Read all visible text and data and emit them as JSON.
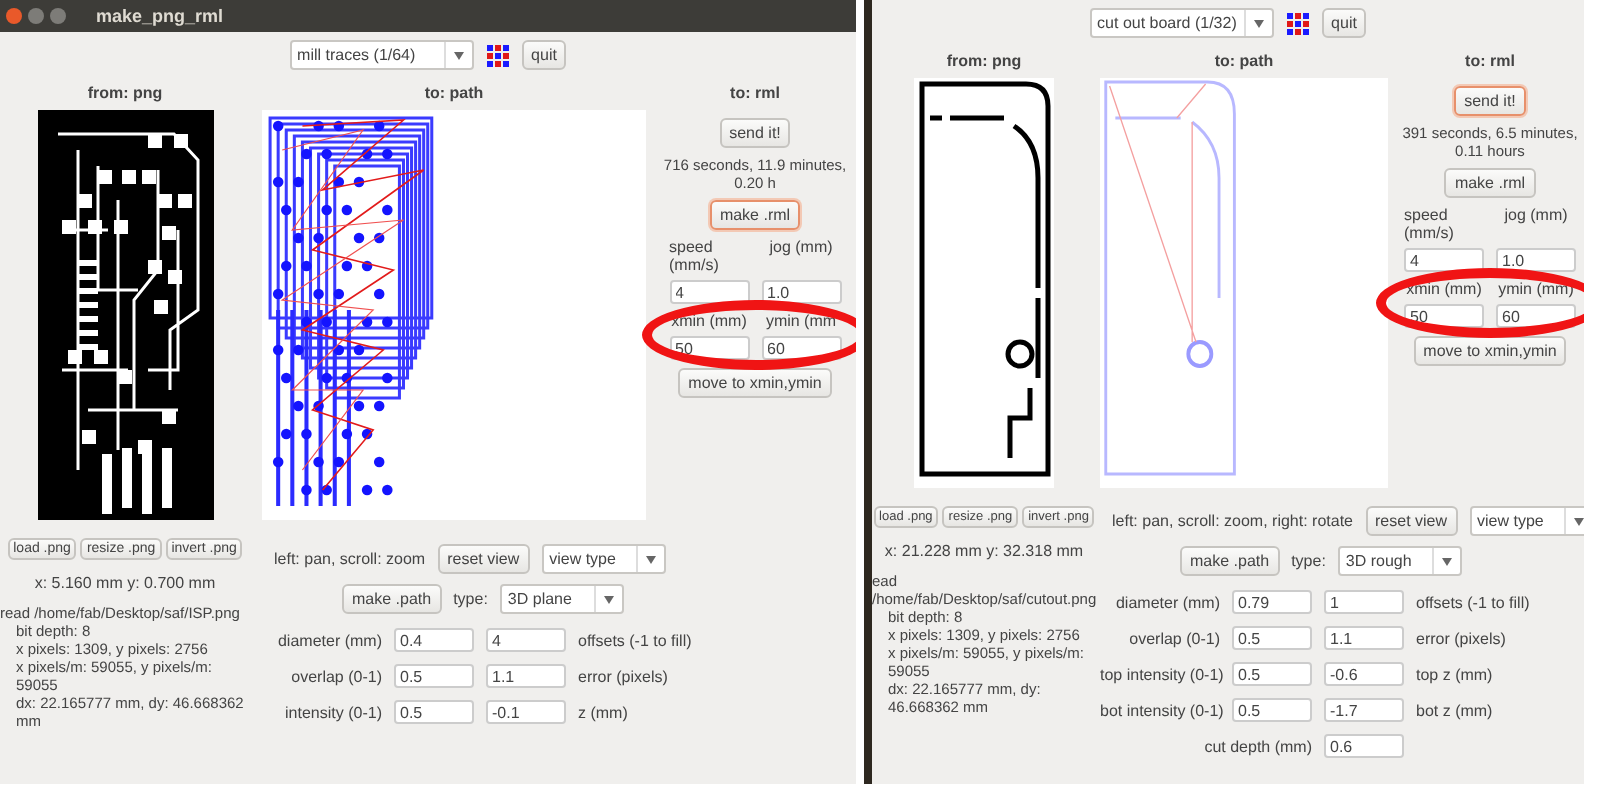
{
  "windows": [
    {
      "title": "make_png_rml",
      "toolbar": {
        "mode": "mill traces (1/64)",
        "quit": "quit"
      },
      "from_panel": {
        "heading": "from: png",
        "kind": "traces"
      },
      "path_panel": {
        "heading": "to: path",
        "kind": "traces"
      },
      "rml_panel": {
        "heading": "to: rml",
        "send": {
          "label": "send it!",
          "focused": false
        },
        "estimate": "716 seconds, 11.9 minutes, 0.20 h",
        "make": {
          "label": "make .rml",
          "focused": true
        },
        "speed_label": "speed (mm/s)",
        "jog_label": "jog (mm)",
        "speed": "4",
        "jog": "1.0",
        "xmin_label": "xmin (mm)",
        "ymin_label": "ymin (mm",
        "xmin": "50",
        "ymin": "60",
        "circled": true,
        "move": "move to xmin,ymin"
      },
      "png_buttons": [
        "load .png",
        "resize .png",
        "invert .png"
      ],
      "view_hint": "left: pan, scroll: zoom",
      "reset": "reset view",
      "view_type": "view type",
      "cursor": "x: 5.160 mm y: 0.700 mm",
      "info": [
        "read /home/fab/Desktop/saf/ISP.png",
        "bit depth: 8",
        "x pixels: 1309, y pixels: 2756",
        "x pixels/m: 59055, y pixels/m: 59055",
        "dx: 22.165777 mm, dy: 46.668362 mm"
      ],
      "make_path": "make .path",
      "type_label": "type:",
      "type": "3D plane",
      "params": [
        {
          "kind": "pair",
          "label": "diameter (mm)",
          "value": "0.4",
          "value_2": "4",
          "label_2": "offsets (-1 to fill)"
        },
        {
          "kind": "pair",
          "label": "overlap (0-1)",
          "value": "0.5",
          "value_2": "1.1",
          "label_2": "error (pixels)"
        },
        {
          "kind": "pair",
          "label": "intensity (0-1)",
          "value": "0.5",
          "value_2": "-0.1",
          "label_2": "z (mm)"
        }
      ]
    },
    {
      "toolbar": {
        "mode": "cut out board (1/32)",
        "quit": "quit"
      },
      "from_panel": {
        "heading": "from: png",
        "kind": "outline"
      },
      "path_panel": {
        "heading": "to: path",
        "kind": "outline"
      },
      "rml_panel": {
        "heading": "to: rml",
        "send": {
          "label": "send it!",
          "focused": true
        },
        "estimate": "391 seconds, 6.5 minutes, 0.11 hours",
        "make": {
          "label": "make .rml",
          "focused": false
        },
        "speed_label": "speed (mm/s)",
        "jog_label": "jog (mm)",
        "speed": "4",
        "jog": "1.0",
        "xmin_label": "xmin (mm)",
        "ymin_label": "ymin (mm)",
        "xmin": "50",
        "ymin": "60",
        "circled": true,
        "move": "move to xmin,ymin"
      },
      "png_buttons": [
        "load .png",
        "resize .png",
        "invert .png"
      ],
      "view_hint": "left: pan, scroll: zoom, right: rotate",
      "reset": "reset view",
      "view_type": "view type",
      "cursor": "x: 21.228 mm y: 32.318 mm",
      "info": [
        "ead /home/fab/Desktop/saf/cutout.png",
        "bit depth: 8",
        "x pixels: 1309, y pixels: 2756",
        "x pixels/m: 59055, y pixels/m: 59055",
        "dx: 22.165777 mm, dy: 46.668362 mm"
      ],
      "make_path": "make .path",
      "type_label": "type:",
      "type": "3D rough",
      "params": [
        {
          "kind": "pair",
          "label": "diameter (mm)",
          "value": "0.79",
          "value_2": "1",
          "label_2": "offsets (-1 to fill)"
        },
        {
          "kind": "pair",
          "label": "overlap (0-1)",
          "value": "0.5",
          "value_2": "1.1",
          "label_2": "error (pixels)"
        },
        {
          "kind": "pair",
          "label": "top intensity (0-1)",
          "value": "0.5",
          "value_2": "-0.6",
          "label_2": "top z (mm)"
        },
        {
          "kind": "pair",
          "label": "bot intensity (0-1)",
          "value": "0.5",
          "value_2": "-1.7",
          "label_2": "bot z (mm)"
        },
        {
          "kind": "single",
          "label": "cut depth (mm)",
          "value": "0.6"
        }
      ]
    }
  ]
}
